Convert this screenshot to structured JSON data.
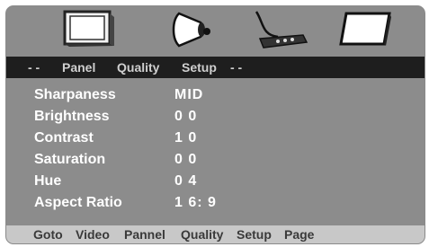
{
  "icons": [
    "panel-tv-icon",
    "quality-lamp-icon",
    "audio-cable-icon",
    "page-display-icon"
  ],
  "menu": {
    "lead_dashes": "- -",
    "tabs": [
      "Panel",
      "Quality",
      "Setup"
    ],
    "trail_dashes": "- -"
  },
  "settings": [
    {
      "label": "Sharpaness",
      "value": "MID"
    },
    {
      "label": "Brightness",
      "value": "0 0"
    },
    {
      "label": "Contrast",
      "value": "1 0"
    },
    {
      "label": "Saturation",
      "value": "0 0"
    },
    {
      "label": "Hue",
      "value": "0 4"
    },
    {
      "label": "Aspect Ratio",
      "value": "1 6: 9"
    }
  ],
  "footer": [
    "Goto",
    "Video",
    "Pannel",
    "Quality",
    "Setup",
    "Page"
  ]
}
